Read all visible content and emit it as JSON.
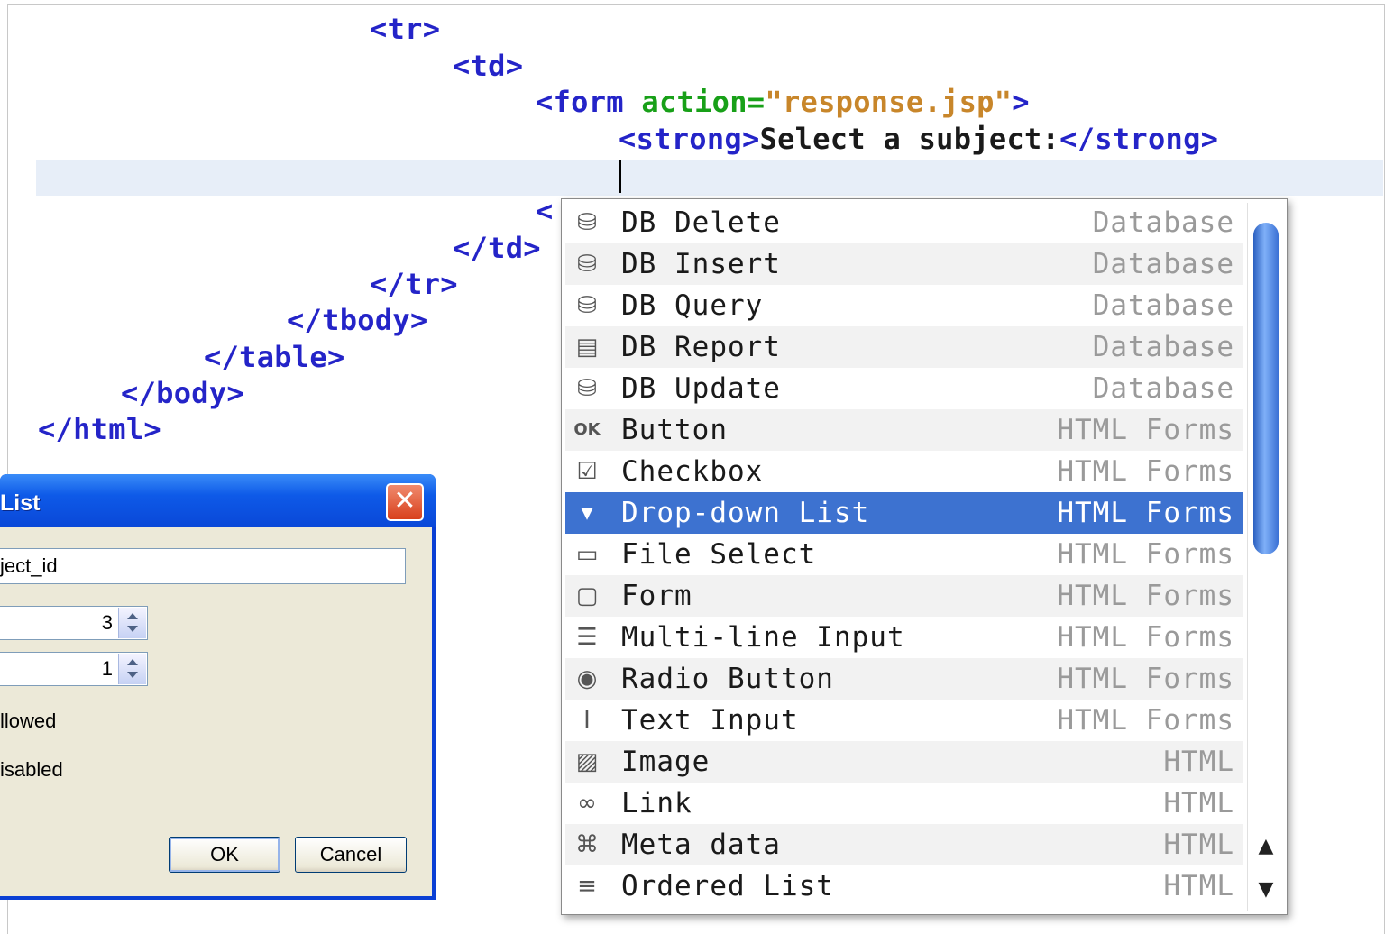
{
  "editor": {
    "lines": {
      "tr_open": "<tr>",
      "td_open": "<td>",
      "form_open_tag": "<form",
      "form_attr": "action=",
      "form_value": "\"response.jsp\"",
      "form_close_bracket": ">",
      "strong_open": "<strong>",
      "strong_text": "Select a subject:",
      "strong_close": "</strong>",
      "hidden_open": "<",
      "td_close": "</td>",
      "tr_close": "</tr>",
      "tbody_close": "</tbody>",
      "table_close": "</table>",
      "body_close": "</body>",
      "html_close": "</html>"
    },
    "colors": {
      "tag": "#2424c8",
      "attribute": "#18a018",
      "value": "#c8862a"
    }
  },
  "dialog": {
    "title": "List",
    "close_glyph": "✕",
    "name_field_value": "ject_id",
    "spinner1_value": "3",
    "spinner2_value": "1",
    "label_allowed": "llowed",
    "label_disabled": "isabled",
    "ok_label": "OK",
    "cancel_label": "Cancel"
  },
  "completion": {
    "items": [
      {
        "label": "DB Delete",
        "category": "Database",
        "icon": "db-delete-icon",
        "glyph": "⛁"
      },
      {
        "label": "DB Insert",
        "category": "Database",
        "icon": "db-insert-icon",
        "glyph": "⛁"
      },
      {
        "label": "DB Query",
        "category": "Database",
        "icon": "db-query-icon",
        "glyph": "⛁"
      },
      {
        "label": "DB Report",
        "category": "Database",
        "icon": "db-report-icon",
        "glyph": "▤"
      },
      {
        "label": "DB Update",
        "category": "Database",
        "icon": "db-update-icon",
        "glyph": "⛁"
      },
      {
        "label": "Button",
        "category": "HTML Forms",
        "icon": "button-icon",
        "glyph": "OK"
      },
      {
        "label": "Checkbox",
        "category": "HTML Forms",
        "icon": "checkbox-icon",
        "glyph": "☑"
      },
      {
        "label": "Drop-down List",
        "category": "HTML Forms",
        "icon": "dropdown-icon",
        "glyph": "▾"
      },
      {
        "label": "File Select",
        "category": "HTML Forms",
        "icon": "file-select-icon",
        "glyph": "▭"
      },
      {
        "label": "Form",
        "category": "HTML Forms",
        "icon": "form-icon",
        "glyph": "▢"
      },
      {
        "label": "Multi-line Input",
        "category": "HTML Forms",
        "icon": "multiline-input-icon",
        "glyph": "☰"
      },
      {
        "label": "Radio Button",
        "category": "HTML Forms",
        "icon": "radio-button-icon",
        "glyph": "◉"
      },
      {
        "label": "Text Input",
        "category": "HTML Forms",
        "icon": "text-input-icon",
        "glyph": "I"
      },
      {
        "label": "Image",
        "category": "HTML",
        "icon": "image-icon",
        "glyph": "▨"
      },
      {
        "label": "Link",
        "category": "HTML",
        "icon": "link-icon",
        "glyph": "∞"
      },
      {
        "label": "Meta data",
        "category": "HTML",
        "icon": "meta-data-icon",
        "glyph": "⌘"
      },
      {
        "label": "Ordered List",
        "category": "HTML",
        "icon": "ordered-list-icon",
        "glyph": "≡"
      }
    ],
    "selected_index": 7,
    "selection_color": "#3d72d0",
    "scroll_up_glyph": "▲",
    "scroll_down_glyph": "▼"
  }
}
